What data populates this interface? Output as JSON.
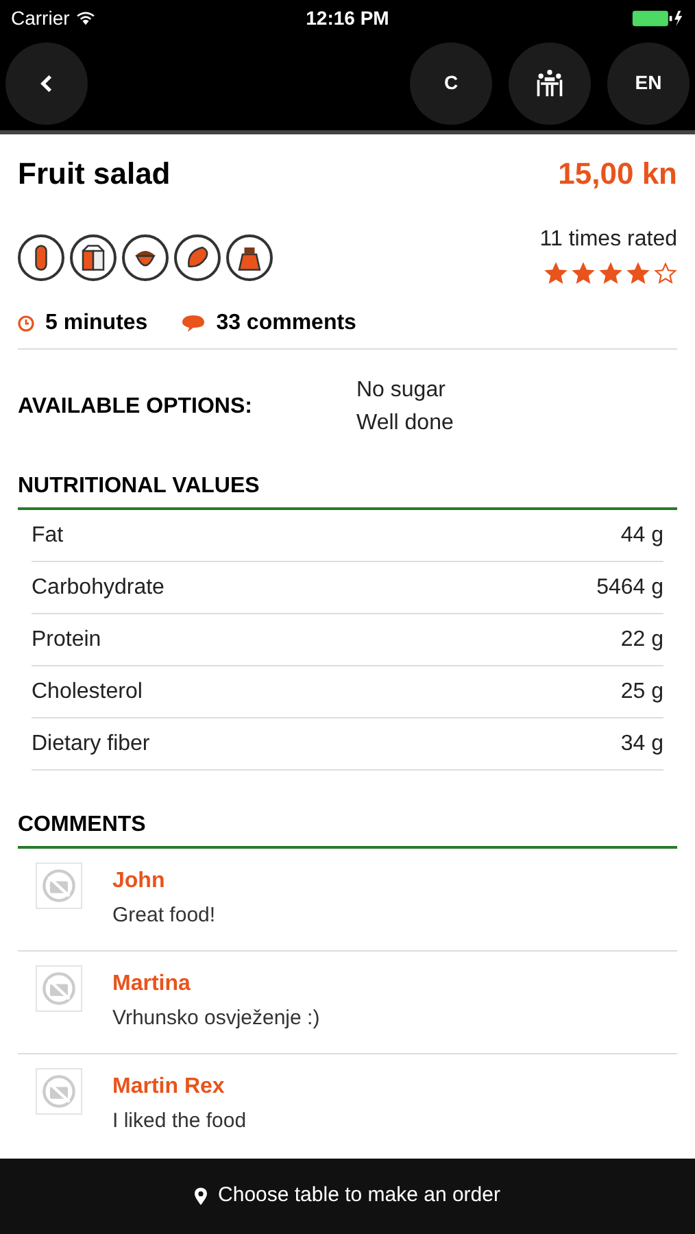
{
  "status_bar": {
    "carrier": "Carrier",
    "time": "12:16 PM"
  },
  "nav": {
    "right_buttons": [
      {
        "kind": "text",
        "label": "C"
      },
      {
        "kind": "icon"
      },
      {
        "kind": "text",
        "label": "EN"
      }
    ]
  },
  "dish": {
    "title": "Fruit salad",
    "price": "15,00 kn",
    "rated": "11 times rated",
    "stars": 4,
    "time": "5 minutes",
    "comments_count": "33 comments"
  },
  "options": {
    "label": "AVAILABLE OPTIONS:",
    "items": [
      "No sugar",
      "Well done"
    ]
  },
  "nutrition": {
    "heading": "NUTRITIONAL VALUES",
    "rows": [
      {
        "name": "Fat",
        "value": "44 g"
      },
      {
        "name": "Carbohydrate",
        "value": "5464 g"
      },
      {
        "name": "Protein",
        "value": "22 g"
      },
      {
        "name": "Cholesterol",
        "value": "25 g"
      },
      {
        "name": "Dietary fiber",
        "value": "34 g"
      }
    ]
  },
  "comments": {
    "heading": "COMMENTS",
    "items": [
      {
        "author": "John",
        "text": "Great food!"
      },
      {
        "author": "Martina",
        "text": "Vrhunsko osvježenje :)"
      },
      {
        "author": "Martin Rex",
        "text": "I liked the food"
      }
    ]
  },
  "footer": {
    "label": "Choose table to make an order"
  }
}
